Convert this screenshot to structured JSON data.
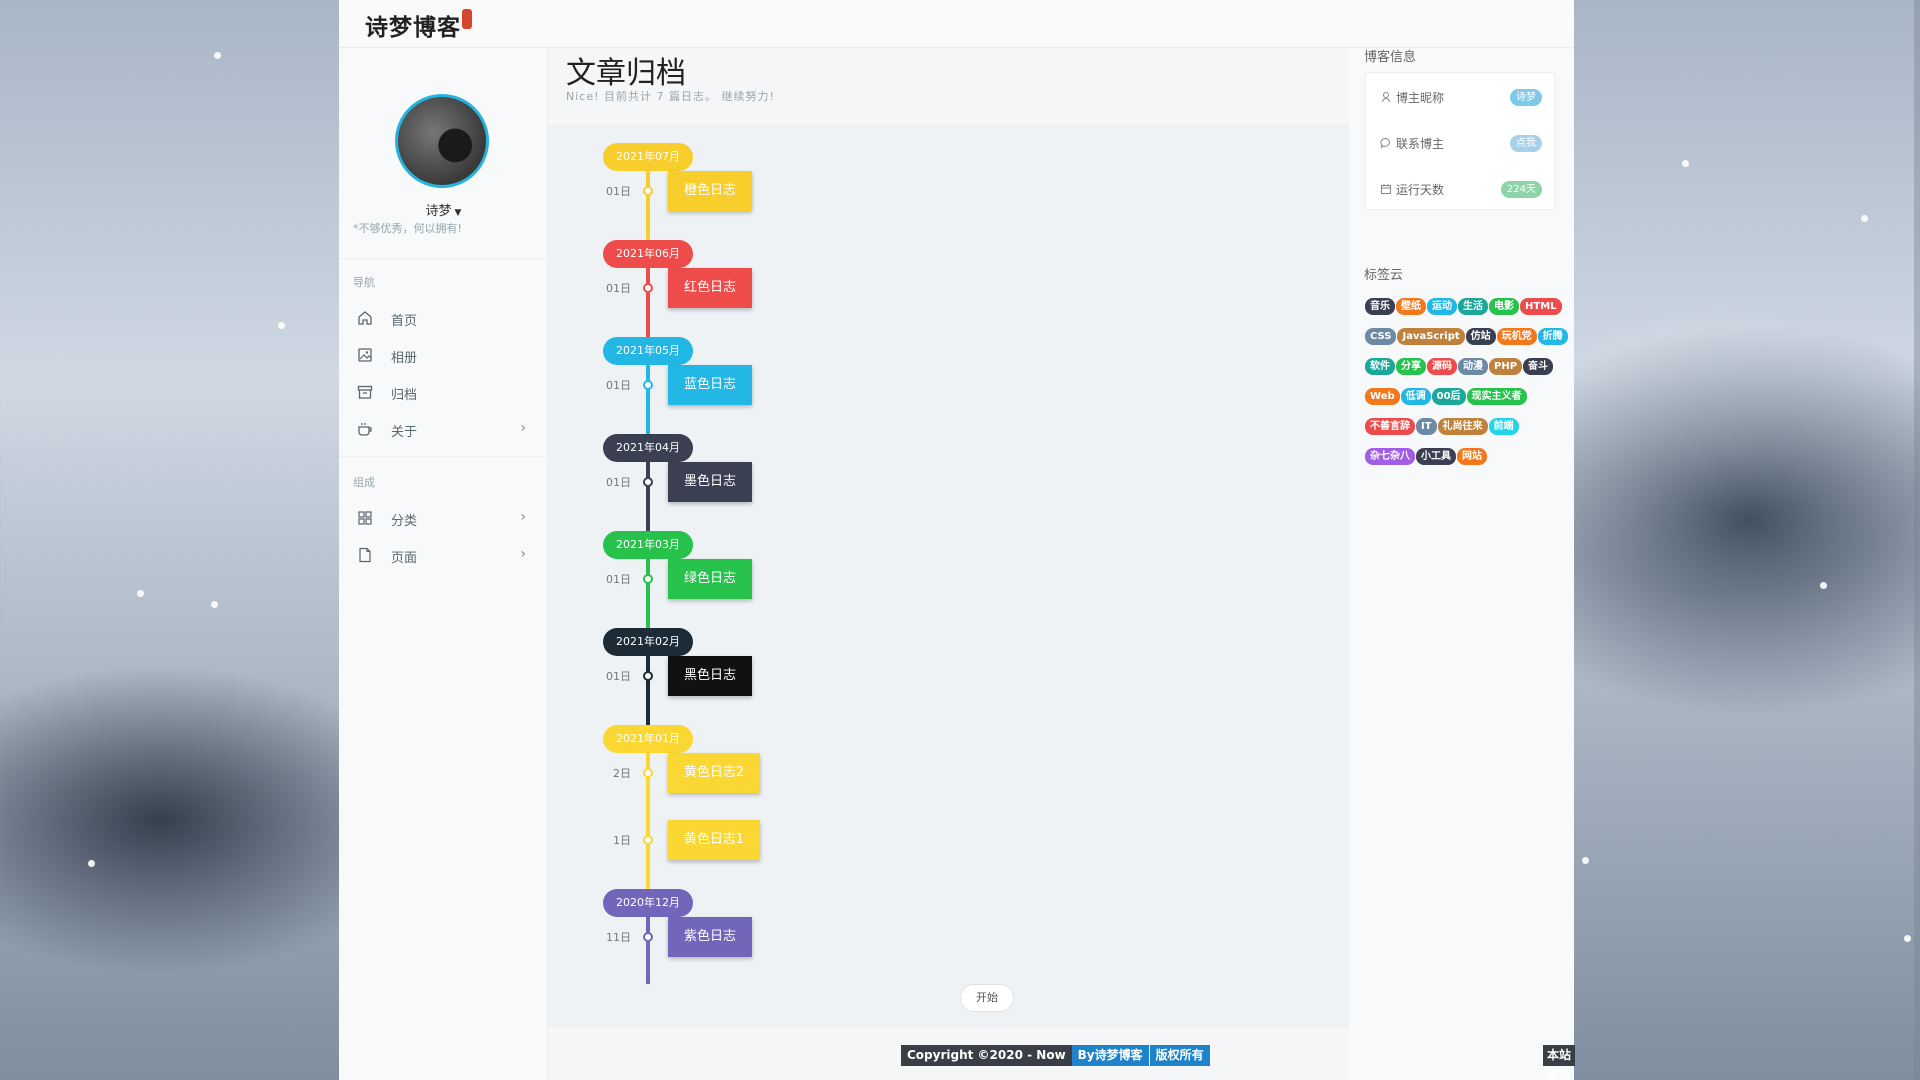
{
  "header": {
    "logo": "诗梦博客"
  },
  "profile": {
    "name": "诗梦",
    "motto": "*不够优秀，何以拥有!"
  },
  "nav": {
    "section1": "导航",
    "items": [
      {
        "label": "首页",
        "icon": "home-icon"
      },
      {
        "label": "相册",
        "icon": "image-icon"
      },
      {
        "label": "归档",
        "icon": "archive-icon"
      },
      {
        "label": "关于",
        "icon": "coffee-icon"
      }
    ],
    "section2": "组成",
    "items2": [
      {
        "label": "分类",
        "icon": "grid-icon"
      },
      {
        "label": "页面",
        "icon": "file-icon"
      }
    ]
  },
  "main": {
    "title": "文章归档",
    "subtitle": "Nice! 目前共计 7 篇日志。 继续努力!",
    "start_label": "开始"
  },
  "timeline": [
    {
      "month": "2021年07月",
      "color": "#f8ce2c",
      "posts": [
        {
          "day": "01日",
          "title": "橙色日志"
        }
      ]
    },
    {
      "month": "2021年06月",
      "color": "#ee4b4b",
      "posts": [
        {
          "day": "01日",
          "title": "红色日志"
        }
      ]
    },
    {
      "month": "2021年05月",
      "color": "#23b7e5",
      "posts": [
        {
          "day": "01日",
          "title": "蓝色日志"
        }
      ]
    },
    {
      "month": "2021年04月",
      "color": "#3a3f51",
      "posts": [
        {
          "day": "01日",
          "title": "墨色日志"
        }
      ]
    },
    {
      "month": "2021年03月",
      "color": "#27c24c",
      "posts": [
        {
          "day": "01日",
          "title": "绿色日志"
        }
      ]
    },
    {
      "month": "2021年02月",
      "color": "#1c2b36",
      "post_color": "#111111",
      "posts": [
        {
          "day": "01日",
          "title": "黑色日志"
        }
      ]
    },
    {
      "month": "2021年01月",
      "color": "#fad733",
      "posts": [
        {
          "day": "2日",
          "title": "黄色日志2"
        },
        {
          "day": "1日",
          "title": "黄色日志1"
        }
      ]
    },
    {
      "month": "2020年12月",
      "color": "#7266ba",
      "posts": [
        {
          "day": "11日",
          "title": "紫色日志"
        }
      ]
    }
  ],
  "blog_info": {
    "heading": "博客信息",
    "rows": [
      {
        "label": "博主昵称",
        "value": "诗梦",
        "color": "#7ec8e8",
        "icon": "user-icon"
      },
      {
        "label": "联系博主",
        "value": "点我",
        "color": "#a8d0ea",
        "icon": "chat-icon"
      },
      {
        "label": "运行天数",
        "value": "224天",
        "color": "#8fd3a8",
        "icon": "calendar-icon"
      }
    ]
  },
  "tag_cloud": {
    "heading": "标签云",
    "tags": [
      {
        "label": "音乐",
        "color": "#3a3f51"
      },
      {
        "label": "壁纸",
        "color": "#f3771b"
      },
      {
        "label": "运动",
        "color": "#23b7e5"
      },
      {
        "label": "生活",
        "color": "#1ba79a"
      },
      {
        "label": "电影",
        "color": "#27c24c"
      },
      {
        "label": "HTML",
        "color": "#ee4b4b"
      },
      {
        "label": "CSS",
        "color": "#6c8aa5"
      },
      {
        "label": "JavaScript",
        "color": "#c0813d"
      },
      {
        "label": "仿站",
        "color": "#3a3f51"
      },
      {
        "label": "玩机党",
        "color": "#f3771b"
      },
      {
        "label": "折腾",
        "color": "#23b7e5"
      },
      {
        "label": "软件",
        "color": "#1ba79a"
      },
      {
        "label": "分享",
        "color": "#27c24c"
      },
      {
        "label": "源码",
        "color": "#ee4b4b"
      },
      {
        "label": "动漫",
        "color": "#6c8aa5"
      },
      {
        "label": "PHP",
        "color": "#c0813d"
      },
      {
        "label": "奋斗",
        "color": "#3a3f51"
      },
      {
        "label": "Web",
        "color": "#f3771b"
      },
      {
        "label": "低调",
        "color": "#23b7e5"
      },
      {
        "label": "00后",
        "color": "#1ba79a"
      },
      {
        "label": "现实主义者",
        "color": "#27c24c"
      },
      {
        "label": "不善言辞",
        "color": "#ee4b4b"
      },
      {
        "label": "IT",
        "color": "#6c8aa5"
      },
      {
        "label": "礼尚往来",
        "color": "#c0813d"
      },
      {
        "label": "前端",
        "color": "#23d5e8"
      },
      {
        "label": "杂七杂八",
        "color": "#a25ce6"
      },
      {
        "label": "小工具",
        "color": "#3a3f51"
      },
      {
        "label": "网站",
        "color": "#f3771b"
      }
    ]
  },
  "footer": {
    "copyright": "Copyright ©2020 - Now",
    "by": "By诗梦博客",
    "rights": "版权所有",
    "disclaimer": "本站部分素材采集于网络，如有侵权，请联系站长及时删除"
  }
}
